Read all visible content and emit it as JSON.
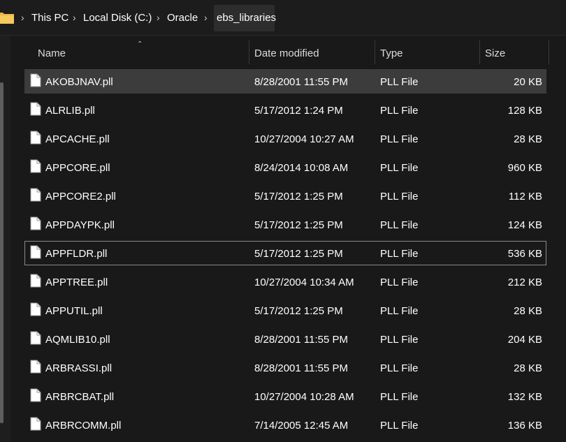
{
  "breadcrumb": {
    "items": [
      "This PC",
      "Local Disk (C:)",
      "Oracle",
      "ebs_libraries"
    ]
  },
  "columns": {
    "name": "Name",
    "date_modified": "Date modified",
    "type": "Type",
    "size": "Size",
    "sort": "Name ascending"
  },
  "files": [
    {
      "name": "AKOBJNAV.pll",
      "date": "8/28/2001 11:55 PM",
      "type": "PLL File",
      "size": "20 KB"
    },
    {
      "name": "ALRLIB.pll",
      "date": "5/17/2012 1:24 PM",
      "type": "PLL File",
      "size": "128 KB"
    },
    {
      "name": "APCACHE.pll",
      "date": "10/27/2004 10:27 AM",
      "type": "PLL File",
      "size": "28 KB"
    },
    {
      "name": "APPCORE.pll",
      "date": "8/24/2014 10:08 AM",
      "type": "PLL File",
      "size": "960 KB"
    },
    {
      "name": "APPCORE2.pll",
      "date": "5/17/2012 1:25 PM",
      "type": "PLL File",
      "size": "112 KB"
    },
    {
      "name": "APPDAYPK.pll",
      "date": "5/17/2012 1:25 PM",
      "type": "PLL File",
      "size": "124 KB"
    },
    {
      "name": "APPFLDR.pll",
      "date": "5/17/2012 1:25 PM",
      "type": "PLL File",
      "size": "536 KB"
    },
    {
      "name": "APPTREE.pll",
      "date": "10/27/2004 10:34 AM",
      "type": "PLL File",
      "size": "212 KB"
    },
    {
      "name": "APPUTIL.pll",
      "date": "5/17/2012 1:25 PM",
      "type": "PLL File",
      "size": "28 KB"
    },
    {
      "name": "AQMLIB10.pll",
      "date": "8/28/2001 11:55 PM",
      "type": "PLL File",
      "size": "204 KB"
    },
    {
      "name": "ARBRASSI.pll",
      "date": "8/28/2001 11:55 PM",
      "type": "PLL File",
      "size": "28 KB"
    },
    {
      "name": "ARBRCBAT.pll",
      "date": "10/27/2004 10:28 AM",
      "type": "PLL File",
      "size": "132 KB"
    },
    {
      "name": "ARBRCOMM.pll",
      "date": "7/14/2005 12:45 AM",
      "type": "PLL File",
      "size": "136 KB"
    }
  ],
  "selection": {
    "selected": "AKOBJNAV.pll",
    "focused": "APPFLDR.pll"
  },
  "icons": {
    "folder": "folder-icon",
    "separator": "chevron-right-icon",
    "file": "file-icon",
    "sort": "sort-up-icon"
  },
  "colors": {
    "background": "#191919",
    "selected_row": "#3c3c3c",
    "folder": "#e8b64a",
    "text": "#ffffff"
  }
}
